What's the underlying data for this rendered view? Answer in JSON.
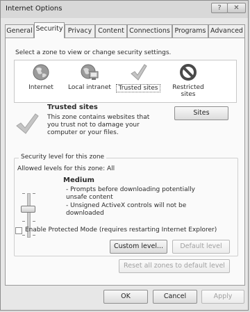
{
  "window": {
    "title": "Internet Options"
  },
  "tabs": [
    {
      "label": "General"
    },
    {
      "label": "Security"
    },
    {
      "label": "Privacy"
    },
    {
      "label": "Content"
    },
    {
      "label": "Connections"
    },
    {
      "label": "Programs"
    },
    {
      "label": "Advanced"
    }
  ],
  "security": {
    "select_zone_text": "Select a zone to view or change security settings.",
    "zones": [
      {
        "label": "Internet",
        "icon": "globe-icon"
      },
      {
        "label": "Local intranet",
        "icon": "intranet-icon"
      },
      {
        "label": "Trusted sites",
        "icon": "checkmark-icon"
      },
      {
        "label": "Restricted sites",
        "icon": "restricted-icon"
      }
    ],
    "selected_zone": {
      "title": "Trusted sites",
      "description": "This zone contains websites that you trust not to damage your computer or your files.",
      "sites_button": "Sites"
    },
    "level_group": {
      "legend": "Security level for this zone",
      "allowed_levels": "Allowed levels for this zone: All",
      "level_name": "Medium",
      "bullet1": "- Prompts before downloading potentially unsafe content",
      "bullet2": "- Unsigned ActiveX controls will not be downloaded",
      "protected_mode": "Enable Protected Mode (requires restarting Internet Explorer)",
      "custom_level_button": "Custom level...",
      "default_level_button": "Default level"
    },
    "reset_all_button": "Reset all zones to default level"
  },
  "footer": {
    "ok": "OK",
    "cancel": "Cancel",
    "apply": "Apply"
  }
}
